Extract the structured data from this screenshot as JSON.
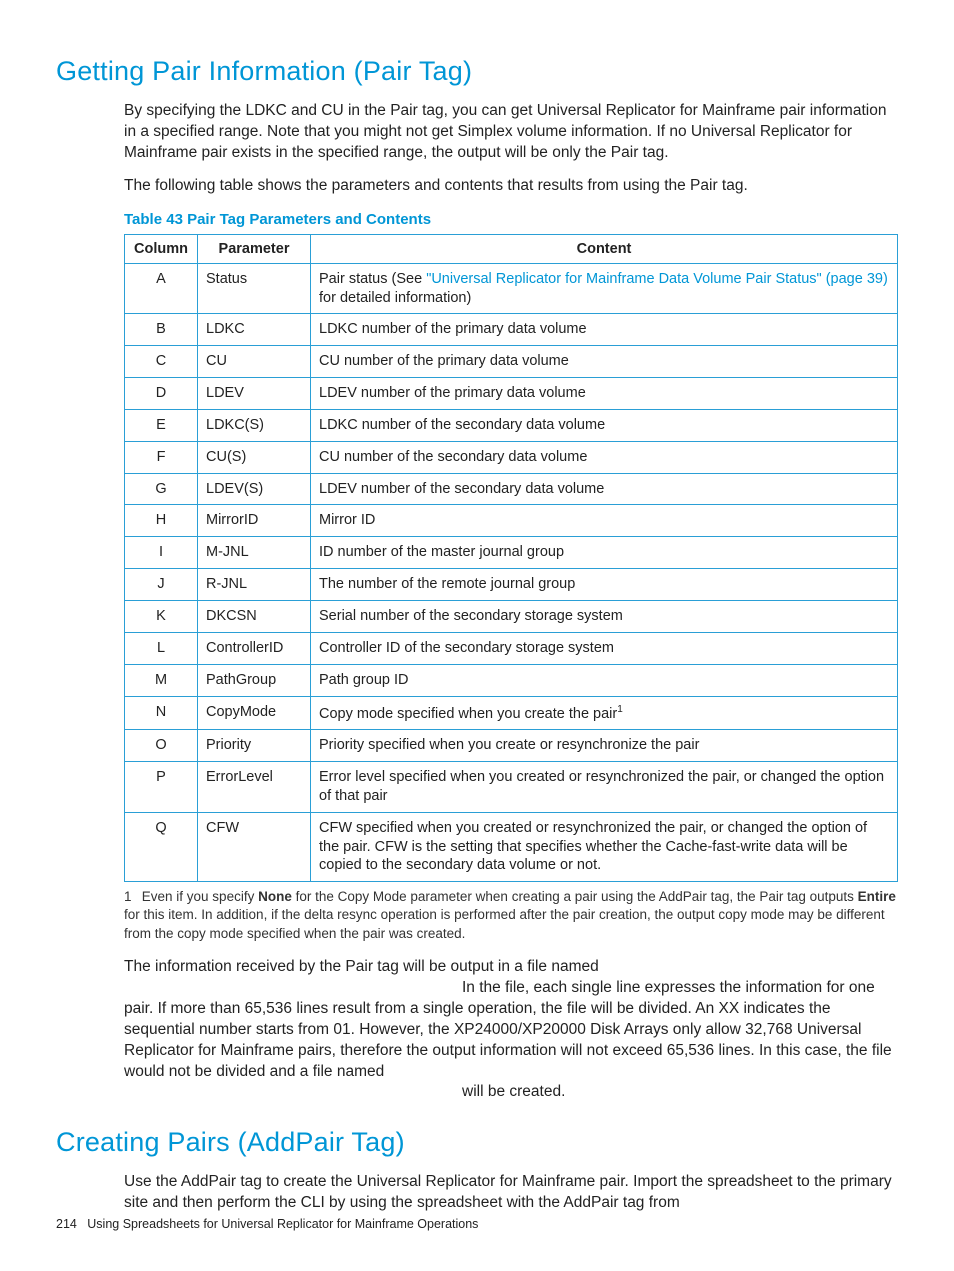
{
  "section1": {
    "heading": "Getting Pair Information (Pair Tag)",
    "p1": "By specifying the LDKC and CU in the Pair tag, you can get Universal Replicator for Mainframe pair information in a specified range. Note that you might not get Simplex volume information. If no Universal Replicator for Mainframe pair exists in the specified range, the output will be only the Pair tag.",
    "p2": "The following table shows the parameters and contents that results from using the Pair tag.",
    "tableCaption": "Table 43 Pair Tag Parameters and Contents"
  },
  "tableHeaders": {
    "c": "Column",
    "p": "Parameter",
    "d": "Content"
  },
  "rows": [
    {
      "c": "A",
      "p": "Status",
      "d_pre": "Pair status (See ",
      "d_link": "\"Universal Replicator for Mainframe Data Volume Pair Status\" (page 39)",
      "d_post": " for detailed information)"
    },
    {
      "c": "B",
      "p": "LDKC",
      "d": "LDKC number of the primary data volume"
    },
    {
      "c": "C",
      "p": "CU",
      "d": "CU number of the primary data volume"
    },
    {
      "c": "D",
      "p": "LDEV",
      "d": "LDEV number of the primary data volume"
    },
    {
      "c": "E",
      "p": "LDKC(S)",
      "d": "LDKC number of the secondary data volume"
    },
    {
      "c": "F",
      "p": "CU(S)",
      "d": "CU number of the secondary data volume"
    },
    {
      "c": "G",
      "p": "LDEV(S)",
      "d": "LDEV number of the secondary data volume"
    },
    {
      "c": "H",
      "p": "MirrorID",
      "d": "Mirror ID"
    },
    {
      "c": "I",
      "p": "M-JNL",
      "d": "ID number of the master journal group"
    },
    {
      "c": "J",
      "p": "R-JNL",
      "d": "The number of the remote journal group"
    },
    {
      "c": "K",
      "p": "DKCSN",
      "d": "Serial number of the secondary storage system"
    },
    {
      "c": "L",
      "p": "ControllerID",
      "d": "Controller ID of the secondary storage system"
    },
    {
      "c": "M",
      "p": "PathGroup",
      "d": "Path group ID"
    },
    {
      "c": "N",
      "p": "CopyMode",
      "d": "Copy mode specified when you create the pair",
      "sup": "1"
    },
    {
      "c": "O",
      "p": "Priority",
      "d": "Priority specified when you create or resynchronize the pair"
    },
    {
      "c": "P",
      "p": "ErrorLevel",
      "d": "Error level specified when you created or resynchronized the pair, or changed the option of that pair"
    },
    {
      "c": "Q",
      "p": "CFW",
      "d": "CFW specified when you created or resynchronized the pair, or changed the option of the pair. CFW is the setting that specifies whether the Cache-fast-write data will be copied to the secondary data volume or not."
    }
  ],
  "footnote": {
    "num": "1",
    "pre": "Even if you specify ",
    "b1": "None",
    "mid": " for the Copy Mode parameter when creating a pair using the AddPair tag, the Pair tag outputs ",
    "b2": "Entire",
    "post": " for this item. In addition, if the delta resync operation is performed after the pair creation, the output copy mode may be different from the copy mode specified when the pair was created."
  },
  "after": {
    "line1": "The information received by the Pair tag will be output in a file named",
    "line2": "In the file, each single line expresses the information for one pair. If more than 65,536 lines result from a single operation, the file will be divided. An XX indicates the sequential number starts from 01. However, the XP24000/XP20000 Disk Arrays only allow 32,768 Universal Replicator for Mainframe pairs, therefore the output information will not exceed 65,536 lines. In this case, the file would not be divided and a file named",
    "line3": "will be created."
  },
  "section2": {
    "heading": "Creating Pairs (AddPair Tag)",
    "p1": "Use the AddPair tag to create the Universal Replicator for Mainframe pair. Import the spreadsheet to the primary site and then perform the CLI by using the spreadsheet with the AddPair tag from"
  },
  "footer": {
    "pageNum": "214",
    "chapter": "Using Spreadsheets for Universal Replicator for Mainframe Operations"
  }
}
